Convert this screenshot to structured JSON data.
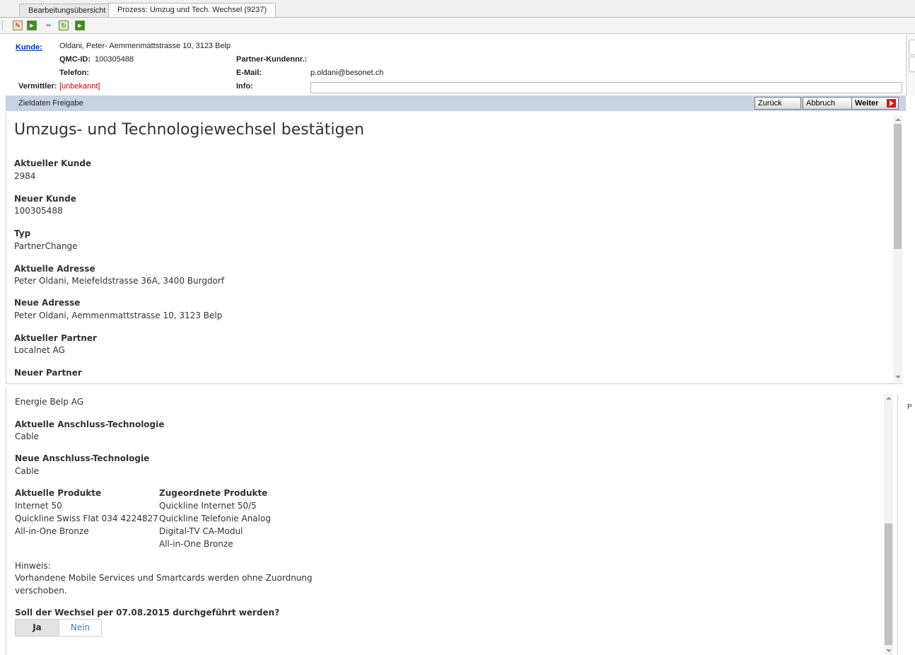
{
  "tabs": [
    {
      "label": "Bearbeitungsübersicht"
    },
    {
      "label": "Prozess: Umzug und Tech. Wechsel (9237)"
    }
  ],
  "toolbar": {
    "icons": [
      "edit-icon",
      "forward-icon",
      "pencil-icon",
      "refresh-icon",
      "export-icon"
    ]
  },
  "customer": {
    "kunde_label": "Kunde:",
    "kunde_value": "Oldani, Peter- Aemmenmattstrasse 10, 3123 Belp",
    "qmc_label": "QMC-ID:",
    "qmc_value": "100305488",
    "partner_kundennr_label": "Partner-Kundennr.:",
    "partner_kundennr_value": "",
    "telefon_label": "Telefon:",
    "telefon_value": "",
    "email_label": "E-Mail:",
    "email_value": "p.oldani@besonet.ch",
    "vermittler_label": "Vermittler:",
    "vermittler_value": "[unbekannt]",
    "info_label": "Info:",
    "info_value": ""
  },
  "stepbar": {
    "title": "Zieldaten Freigabe",
    "back_label": "Zurück",
    "cancel_label": "Abbruch",
    "next_label": "Weiter"
  },
  "main": {
    "heading": "Umzugs- und Technologiewechsel bestätigen",
    "fields1": [
      {
        "label": "Aktueller Kunde",
        "value": "2984"
      },
      {
        "label": "Neuer Kunde",
        "value": "100305488"
      },
      {
        "label": "Typ",
        "value": "PartnerChange"
      },
      {
        "label": "Aktuelle Adresse",
        "value": "Peter Oldani, Meiefeldstrasse 36A, 3400 Burgdorf"
      },
      {
        "label": "Neue Adresse",
        "value": "Peter Oldani, Aemmenmattstrasse 10, 3123 Belp"
      },
      {
        "label": "Aktueller Partner",
        "value": "Localnet AG"
      },
      {
        "label": "Neuer Partner"
      }
    ],
    "neuer_partner_value": "Energie Belp AG",
    "fields2": [
      {
        "label": "Aktuelle Anschluss-Technologie",
        "value": "Cable"
      },
      {
        "label": "Neue Anschluss-Technologie",
        "value": "Cable"
      }
    ],
    "aktuelle_produkte_label": "Aktuelle Produkte",
    "aktuelle_produkte": [
      "Internet 50",
      "Quickline Swiss Flat 034 4224827",
      "All-in-One Bronze"
    ],
    "zugeordnete_produkte_label": "Zugeordnete Produkte",
    "zugeordnete_produkte": [
      "Quickline Internet 50/5",
      "Quickline Telefonie Analog",
      "Digital-TV CA-Modul",
      "All-in-One Bronze"
    ],
    "hinweis_label": "Hinweis:",
    "hinweis_line1": "Vorhandene Mobile Services und Smartcards werden ohne Zuordnung",
    "hinweis_line2": "verschoben.",
    "question": "Soll der Wechsel per 07.08.2015 durchgeführt werden?",
    "yes_label": "Ja",
    "no_label": "Nein"
  },
  "side_letter": "P",
  "colors": {
    "stepbar_bg": "#c8d2e0",
    "link": "#0033cc",
    "warning": "#d00000",
    "toggle_no": "#3a7bd5"
  }
}
